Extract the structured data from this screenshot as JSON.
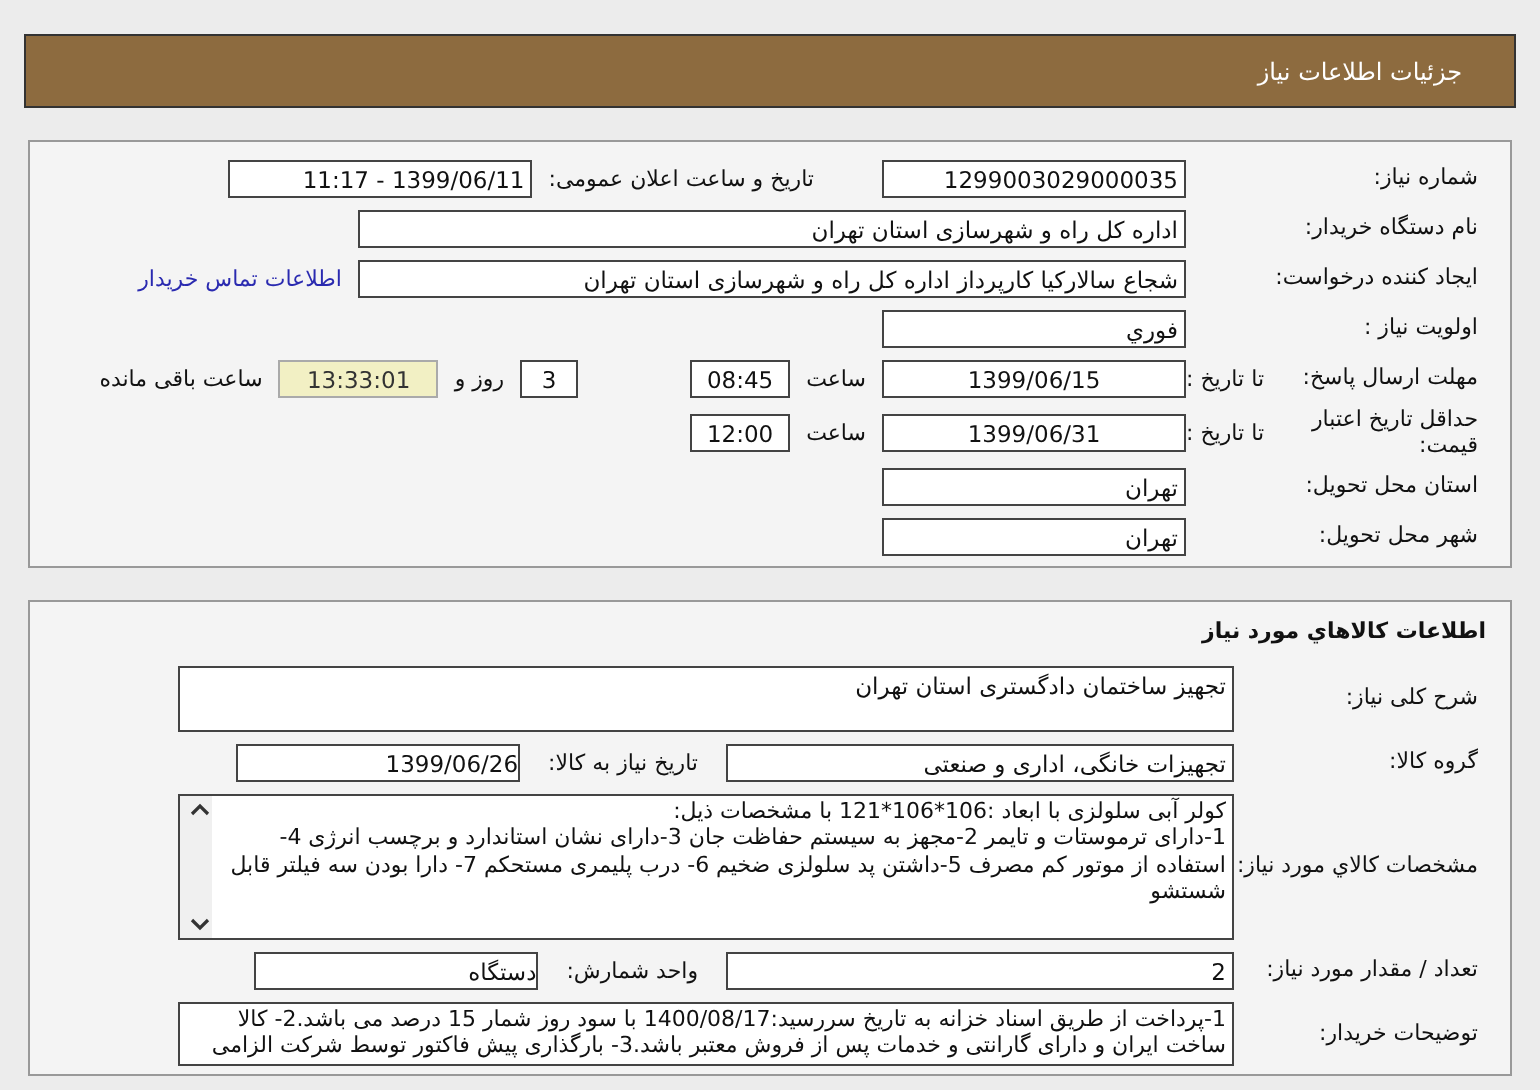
{
  "header": {
    "title": "جزئیات اطلاعات نیاز"
  },
  "details": [
    {
      "label": "شماره نیاز:",
      "items": [
        {
          "kind": "field",
          "value": "1299003029000035"
        },
        {
          "kind": "label",
          "value": "تاریخ و ساعت اعلان عمومی:"
        },
        {
          "kind": "field",
          "value": "1399/06/11 - 11:17"
        }
      ]
    },
    {
      "label": "نام دستگاه خریدار:",
      "items": [
        {
          "kind": "wide",
          "value": "اداره کل راه و شهرسازی استان تهران"
        }
      ]
    },
    {
      "label": "ایجاد کننده درخواست:",
      "items": [
        {
          "kind": "wide",
          "value": "شجاع سالارکیا کارپرداز اداره کل راه و شهرسازی استان تهران"
        },
        {
          "kind": "link",
          "value": "اطلاعات تماس خریدار"
        }
      ]
    },
    {
      "label": "اولویت نیاز :",
      "items": [
        {
          "kind": "field",
          "value": "فوري"
        }
      ]
    },
    {
      "label": "مهلت ارسال پاسخ:",
      "sublabel": "تا تاریخ :",
      "items": [
        {
          "kind": "date",
          "value": "1399/06/15"
        },
        {
          "kind": "label",
          "value": "ساعت"
        },
        {
          "kind": "time",
          "value": "08:45"
        },
        {
          "kind": "tiny",
          "value": "3"
        },
        {
          "kind": "label",
          "value": "روز و"
        },
        {
          "kind": "timer",
          "value": "13:33:01"
        },
        {
          "kind": "label",
          "value": "ساعت باقی مانده"
        }
      ]
    },
    {
      "label": "حداقل تاریخ اعتبار قیمت:",
      "sublabel": "تا تاریخ :",
      "items": [
        {
          "kind": "date",
          "value": "1399/06/31"
        },
        {
          "kind": "label",
          "value": "ساعت"
        },
        {
          "kind": "time",
          "value": "12:00"
        }
      ]
    },
    {
      "label": "استان محل تحویل:",
      "items": [
        {
          "kind": "field",
          "value": "تهران"
        }
      ]
    },
    {
      "label": "شهر محل تحویل:",
      "items": [
        {
          "kind": "field",
          "value": "تهران"
        }
      ]
    }
  ],
  "goods": {
    "title": "اطلاعات کالاهاي مورد نیاز",
    "rows": [
      {
        "label": "شرح کلی نیاز:",
        "items": [
          {
            "kind": "area",
            "value": "تجهیز ساختمان دادگستری استان تهران"
          }
        ]
      },
      {
        "label": "گروه کالا:",
        "items": [
          {
            "kind": "field",
            "value": "تجهیزات خانگی، اداری و صنعتی"
          },
          {
            "kind": "label",
            "value": "تاریخ نیاز به کالا:"
          },
          {
            "kind": "short",
            "value": "1399/06/26"
          }
        ]
      },
      {
        "label": "مشخصات کالاي مورد نیاز:",
        "items": [
          {
            "kind": "scrollarea",
            "value": "کولر آبی سلولزی  با ابعاد :106*106*121 با مشخصات ذیل:\n 1-دارای ترموستات و تایمر 2-مجهز به سیستم حفاظت جان 3-دارای نشان استاندارد و برچسب انرژی 4-استفاده از موتور کم مصرف 5-داشتن پد سلولزی ضخیم 6- درب پلیمری مستحکم 7- دارا بودن سه فیلتر قابل شستشو"
          }
        ]
      },
      {
        "label": "تعداد / مقدار مورد نیاز:",
        "items": [
          {
            "kind": "field",
            "value": "2"
          },
          {
            "kind": "label",
            "value": "واحد شمارش:"
          },
          {
            "kind": "short",
            "value": "دستگاه"
          }
        ]
      },
      {
        "label": "توضیحات خریدار:",
        "items": [
          {
            "kind": "notes",
            "value": "1-پرداخت از طریق اسناد خزانه به تاریخ سررسید:1400/08/17 با سود روز شمار 15 درصد می باشد.2- کالا ساخت ایران و دارای گارانتی و خدمات پس از فروش معتبر باشد.3- بارگذاری پیش فاکتور توسط شرکت الزامی"
          }
        ]
      }
    ]
  }
}
